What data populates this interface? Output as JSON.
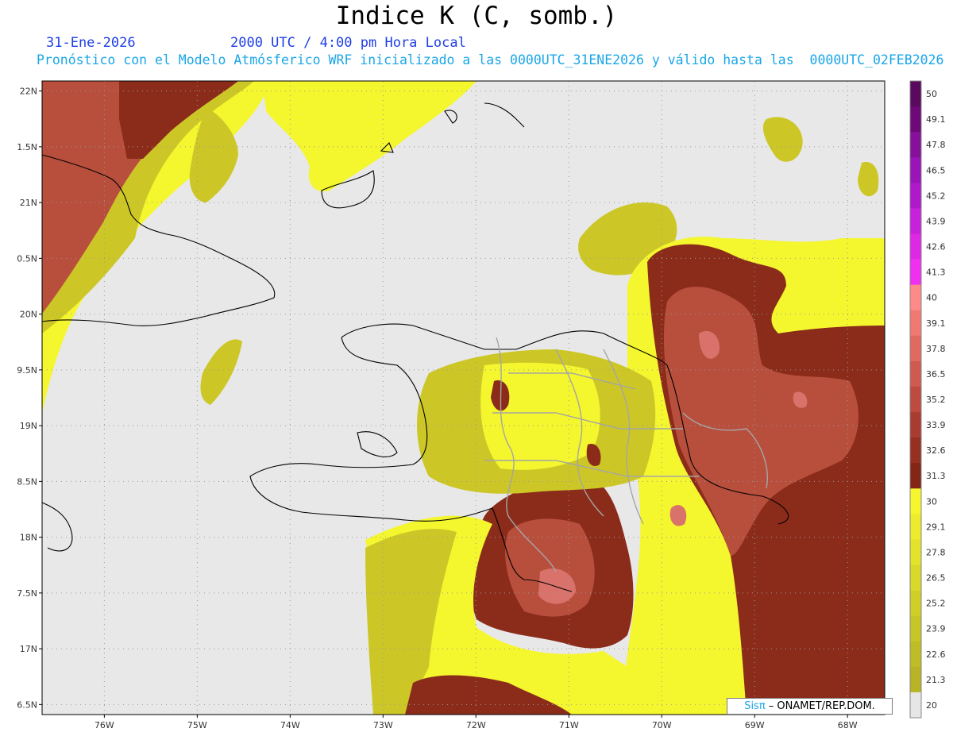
{
  "header": {
    "title": "Indice K (C, somb.)",
    "date": "31-Ene-2026",
    "time": "2000 UTC / 4:00 pm Hora Local",
    "description": "Pronóstico con el Modelo Atmósferico WRF inicializado a las 0000UTC_31ENE2026 y válido hasta las  0000UTC_02FEB2026"
  },
  "map": {
    "lat_labels": [
      "22N",
      "1.5N",
      "21N",
      "0.5N",
      "20N",
      "9.5N",
      "19N",
      "8.5N",
      "18N",
      "7.5N",
      "17N",
      "6.5N"
    ],
    "lon_labels": [
      "76W",
      "75W",
      "74W",
      "73W",
      "72W",
      "71W",
      "70W",
      "69W",
      "68W"
    ],
    "lon_range": [
      -76.67,
      -67.6
    ],
    "lat_range": [
      16.41,
      22.09
    ],
    "colors": {
      "land_bg": "#e8e8e8",
      "yellow": "#f4f62e",
      "olive": "#ccc727",
      "olive_light": "#dada2a",
      "dark_red": "#8b2c1b",
      "red": "#b84f3d",
      "salmon": "#d9726a",
      "coast": "#000000",
      "borders": "#9a9a9a"
    }
  },
  "colorbar": {
    "labels": [
      "50",
      "49.1",
      "47.8",
      "46.5",
      "45.2",
      "43.9",
      "42.6",
      "41.3",
      "40",
      "39.1",
      "37.8",
      "36.5",
      "35.2",
      "33.9",
      "32.6",
      "31.3",
      "30",
      "29.1",
      "27.8",
      "26.5",
      "25.2",
      "23.9",
      "22.6",
      "21.3",
      "20"
    ],
    "segments": [
      "#5a0a5e",
      "#6e0a78",
      "#85109a",
      "#9a14b8",
      "#b018cc",
      "#c820dc",
      "#de28e6",
      "#f030ee",
      "#ff8a8a",
      "#f07a72",
      "#e06a60",
      "#cf5a4f",
      "#bd4b3f",
      "#a93c30",
      "#963021",
      "#832615",
      "#f6f62e",
      "#ecec2c",
      "#e3e32b",
      "#d9d929",
      "#d0cf28",
      "#c7c627",
      "#bfbd26",
      "#b8b425",
      "#e6e6e6"
    ]
  },
  "credit": {
    "sis": "Sisπ",
    "rest": " – ONAMET/REP.DOM."
  }
}
